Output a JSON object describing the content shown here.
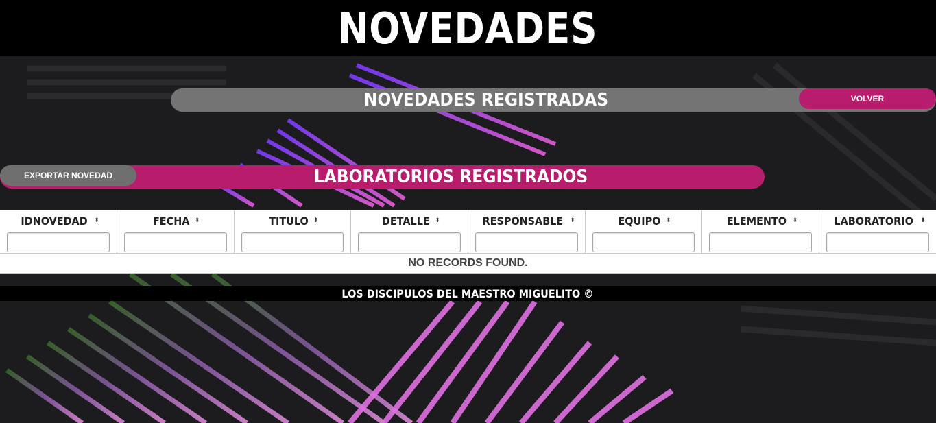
{
  "header": {
    "title": "NOVEDADES"
  },
  "registradas": {
    "title": "NOVEDADES REGISTRADAS",
    "back_label": "VOLVER"
  },
  "laboratorios": {
    "title": "LABORATORIOS REGISTRADOS",
    "export_label": "EXPORTAR NOVEDAD"
  },
  "table": {
    "columns": [
      {
        "label": "IDNOVEDAD"
      },
      {
        "label": "FECHA"
      },
      {
        "label": "TITULO"
      },
      {
        "label": "DETALLE"
      },
      {
        "label": "RESPONSABLE"
      },
      {
        "label": "EQUIPO"
      },
      {
        "label": "ELEMENTO"
      },
      {
        "label": "LABORATORIO"
      }
    ],
    "empty_message": "NO RECORDS FOUND."
  },
  "footer": {
    "text": "LOS DISCIPULOS DEL MAESTRO MIGUELITO ©"
  },
  "colors": {
    "accent": "#b81c6c",
    "bar_gray": "#747474",
    "background": "#1c1c1e"
  },
  "icons": {
    "sort": "sort-icon"
  }
}
